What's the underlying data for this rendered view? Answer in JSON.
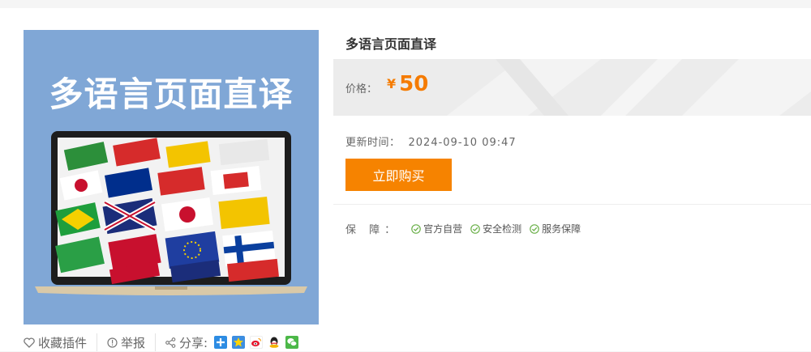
{
  "product": {
    "title": "多语言页面直译",
    "image_title": "多语言页面直译",
    "price_label": "价格：",
    "currency": "¥",
    "price": "50",
    "update_label": "更新时间：",
    "update_time": "2024-09-10 09:47",
    "buy_label": "立即购买"
  },
  "guarantee": {
    "label": "保 障：",
    "items": [
      "官方自营",
      "安全检测",
      "服务保障"
    ]
  },
  "actions": {
    "favorite": "收藏插件",
    "report": "举报",
    "share": "分享:"
  },
  "share_icons": [
    "qzone-icon",
    "star-icon",
    "weibo-icon",
    "qq-icon",
    "wechat-icon"
  ],
  "colors": {
    "accent": "#f68300",
    "price": "#f57b00",
    "check": "#6bb04a"
  }
}
